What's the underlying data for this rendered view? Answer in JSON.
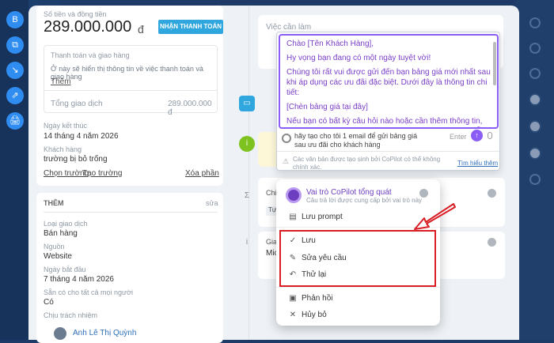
{
  "left_tools": [
    "B",
    "⧉",
    "↘",
    "⇗",
    "🖨"
  ],
  "amount": {
    "label": "Số tiền và đồng tiền",
    "value": "289.000.000",
    "currency": "đ",
    "pay_button": "NHẬN THANH TOÁN"
  },
  "payment": {
    "title": "Thanh toán và giao hàng",
    "desc": "Ở này sẽ hiển thị thông tin về việc thanh toán và giao hàng",
    "more": "Thêm",
    "total_label": "Tổng giao dịch",
    "total_value": "289.000.000 đ"
  },
  "deal": {
    "end_label": "Ngày kết thúc",
    "end_value": "14 tháng 4 năm 2026",
    "client_label": "Khách hàng",
    "client_value": "trường bị bỏ trống",
    "choose_field": "Chọn trường",
    "create_field": "Tạo trường",
    "delete_section": "Xóa phần"
  },
  "more_section": {
    "title": "THÊM",
    "edit": "sửa",
    "type_label": "Loại giao dịch",
    "type_value": "Bán hàng",
    "source_label": "Nguồn",
    "source_value": "Website",
    "start_label": "Ngày bắt đầu",
    "start_value": "7 tháng 4 năm 2026",
    "avail_label": "Sẵn có cho tất cả mọi người",
    "avail_value": "Có",
    "resp_label": "Chịu trách nhiệm",
    "resp_value": "Anh Lê Thị Quỳnh"
  },
  "activity": {
    "todo_placeholder": "Việc cần làm",
    "partial_1": "Chi",
    "partial_2": "Tự",
    "partial_3": "Gia",
    "partial_4": "Mic"
  },
  "copilot": {
    "message": [
      "Chào [Tên Khách Hàng],",
      "Hy vọng bạn đang có một ngày tuyệt vời!",
      "Chúng tôi rất vui được gửi đến bạn bảng giá mới nhất sau khi áp dụng các ưu đãi đặc biệt. Dưới đây là thông tin chi tiết:",
      "[Chèn bảng giá tại đây]",
      "Nếu bạn có bất kỳ câu hỏi nào hoặc cần thêm thông tin, đừng ngần ngại liên hệ với chúng tôi. Chúng tôi luôn sẵn sàng hỗ trợ"
    ],
    "prompt": "hãy tạo cho tôi 1 email để gửi bảng giá sau ưu đãi cho khách hàng",
    "enter_label": "Enter",
    "disclaimer": "Các văn bản được tạo sinh bởi CoPilot có thể không chính xác.",
    "learn_more": "Tìm hiểu thêm"
  },
  "popup": {
    "role_title": "Vai trò CoPilot tổng quát",
    "role_desc": "Câu trả lời được cung cấp bởi vai trò này",
    "save_prompt": "Lưu prompt",
    "save": "Lưu",
    "edit_request": "Sửa yêu cầu",
    "retry": "Thử lại",
    "feedback": "Phản hồi",
    "cancel": "Hủy bỏ"
  },
  "colors": {
    "accent": "#2fa6de",
    "copilot_purple": "#8b5cf6",
    "annotation_red": "#d81f26"
  }
}
